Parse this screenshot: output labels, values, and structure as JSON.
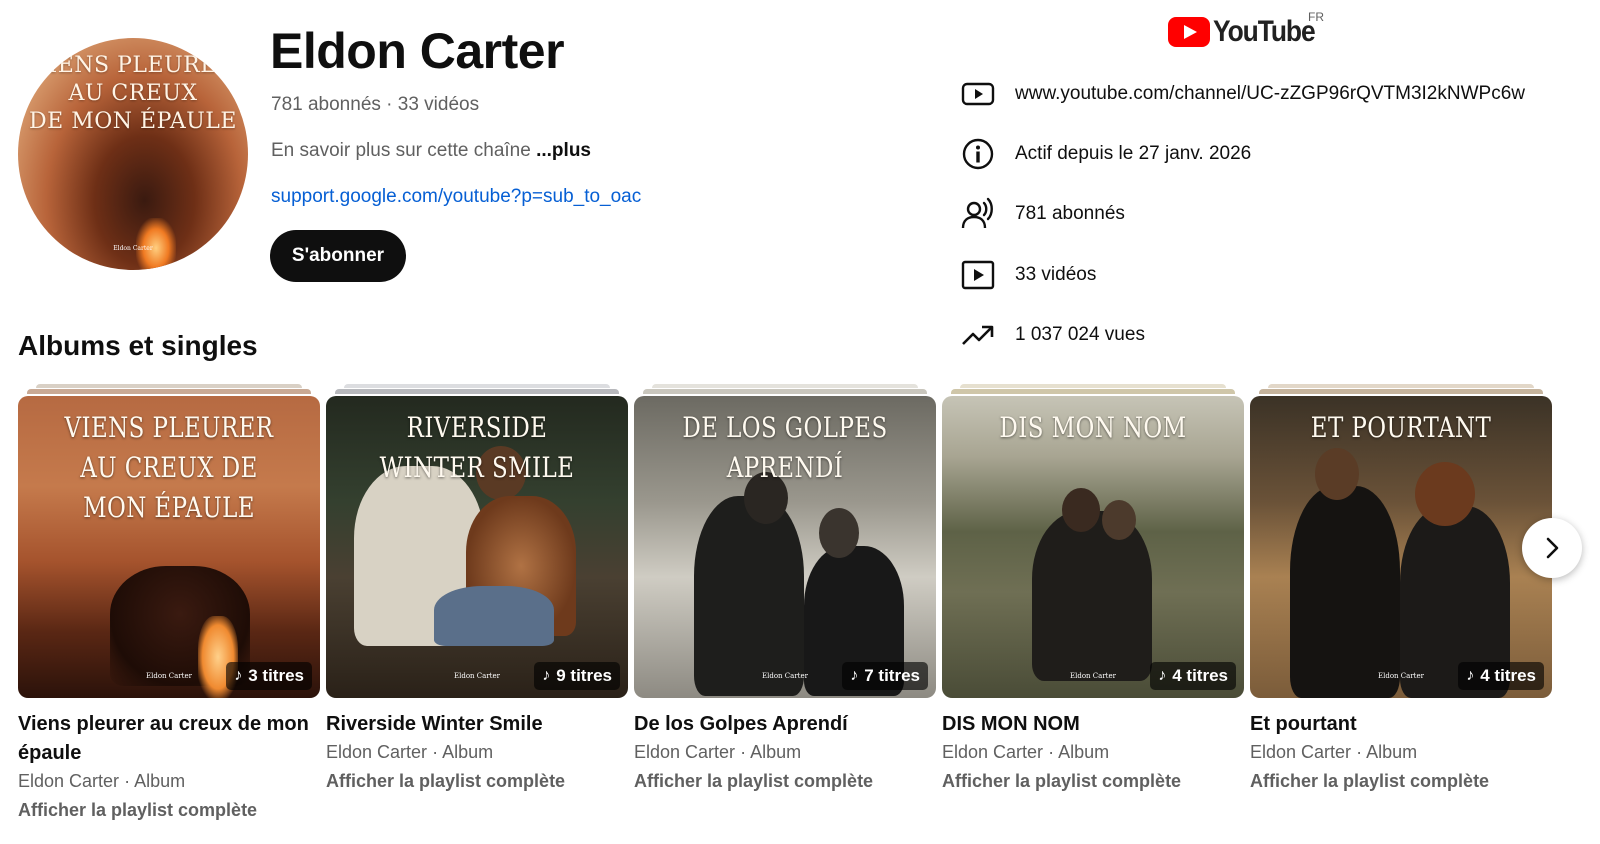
{
  "channel": {
    "name": "Eldon Carter",
    "meta": "781 abonnés · 33 vidéos",
    "about_text": "En savoir plus sur cette chaîne ",
    "about_more": "...plus",
    "link": "support.google.com/youtube?p=sub_to_oac",
    "subscribe_label": "S'abonner",
    "avatar_title": "Viens pleurer au creux\nde mon épaule",
    "avatar_sign": "Eldon Carter"
  },
  "brand": {
    "logo_word": "YouTube",
    "country_code": "FR",
    "logo_color": "#ff0000"
  },
  "info": [
    {
      "icon": "video-link-icon",
      "text": "www.youtube.com/channel/UC-zZGP96rQVTM3I2kNWPc6w"
    },
    {
      "icon": "info-icon",
      "text": "Actif depuis le 27 janv. 2026"
    },
    {
      "icon": "subscribers-icon",
      "text": "781 abonnés"
    },
    {
      "icon": "play-icon",
      "text": "33 vidéos"
    },
    {
      "icon": "trending-icon",
      "text": "1 037 024 vues"
    }
  ],
  "section_title": "Albums et singles",
  "albums": [
    {
      "cover_title": "Viens pleurer au creux de mon épaule",
      "cover_sign": "Eldon Carter",
      "count": "3 titres",
      "title": "Viens pleurer au creux de mon épaule",
      "artist": "Eldon Carter",
      "type": "Album",
      "link": "Afficher la playlist complète"
    },
    {
      "cover_title": "Riverside Winter Smile",
      "cover_sign": "Eldon Carter",
      "count": "9 titres",
      "title": "Riverside Winter Smile",
      "artist": "Eldon Carter",
      "type": "Album",
      "link": "Afficher la playlist complète"
    },
    {
      "cover_title": "De los Golpes Aprendí",
      "cover_sign": "Eldon Carter",
      "count": "7 titres",
      "title": "De los Golpes Aprendí",
      "artist": "Eldon Carter",
      "type": "Album",
      "link": "Afficher la playlist complète"
    },
    {
      "cover_title": "Dis mon nom",
      "cover_sign": "Eldon Carter",
      "count": "4 titres",
      "title": "DIS MON NOM",
      "artist": "Eldon Carter",
      "type": "Album",
      "link": "Afficher la playlist complète"
    },
    {
      "cover_title": "Et pourtant",
      "cover_sign": "Eldon Carter",
      "count": "4 titres",
      "title": "Et pourtant",
      "artist": "Eldon Carter",
      "type": "Album",
      "link": "Afficher la playlist complète"
    }
  ],
  "separator": "·",
  "note_glyph": "♪"
}
